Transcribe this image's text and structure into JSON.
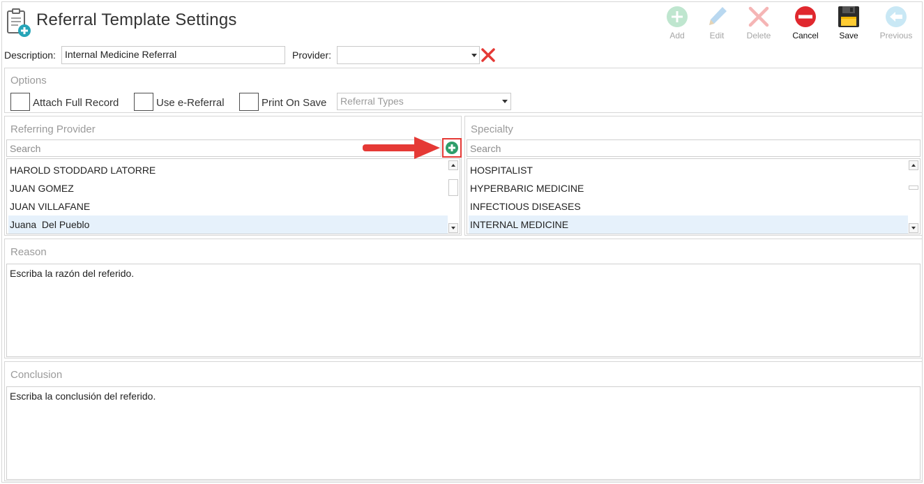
{
  "header": {
    "title": "Referral Template Settings",
    "icon": "clipboard-add-icon"
  },
  "toolbar": {
    "add_label": "Add",
    "edit_label": "Edit",
    "delete_label": "Delete",
    "cancel_label": "Cancel",
    "save_label": "Save",
    "previous_label": "Previous"
  },
  "form": {
    "description_label": "Description:",
    "description_value": "Internal Medicine Referral",
    "provider_label": "Provider:",
    "provider_value": ""
  },
  "options": {
    "title": "Options",
    "attach_full_record_label": "Attach Full Record",
    "use_ereferral_label": "Use e-Referral",
    "print_on_save_label": "Print On Save",
    "referral_types_placeholder": "Referral Types"
  },
  "referring_provider": {
    "title": "Referring Provider",
    "search_placeholder": "Search",
    "items": [
      {
        "label": "HAROLD STODDARD LATORRE"
      },
      {
        "label": "JUAN GOMEZ"
      },
      {
        "label": "JUAN VILLAFANE"
      },
      {
        "label": "Juana  Del Pueblo"
      }
    ],
    "selected_index": 3
  },
  "specialty": {
    "title": "Specialty",
    "search_placeholder": "Search",
    "items": [
      {
        "label": "HOSPITALIST"
      },
      {
        "label": "HYPERBARIC MEDICINE"
      },
      {
        "label": "INFECTIOUS DISEASES"
      },
      {
        "label": "INTERNAL MEDICINE"
      }
    ],
    "selected_index": 3
  },
  "reason": {
    "title": "Reason",
    "text": "Escriba la razón del referido."
  },
  "conclusion": {
    "title": "Conclusion",
    "text": "Escriba la conclusión del referido."
  },
  "colors": {
    "add_green": "#2e9e6a",
    "highlight_red": "#e53935",
    "cancel_red": "#e0282e",
    "selected_row": "#e6f1fb",
    "disabled_label": "#a6a6a6"
  }
}
